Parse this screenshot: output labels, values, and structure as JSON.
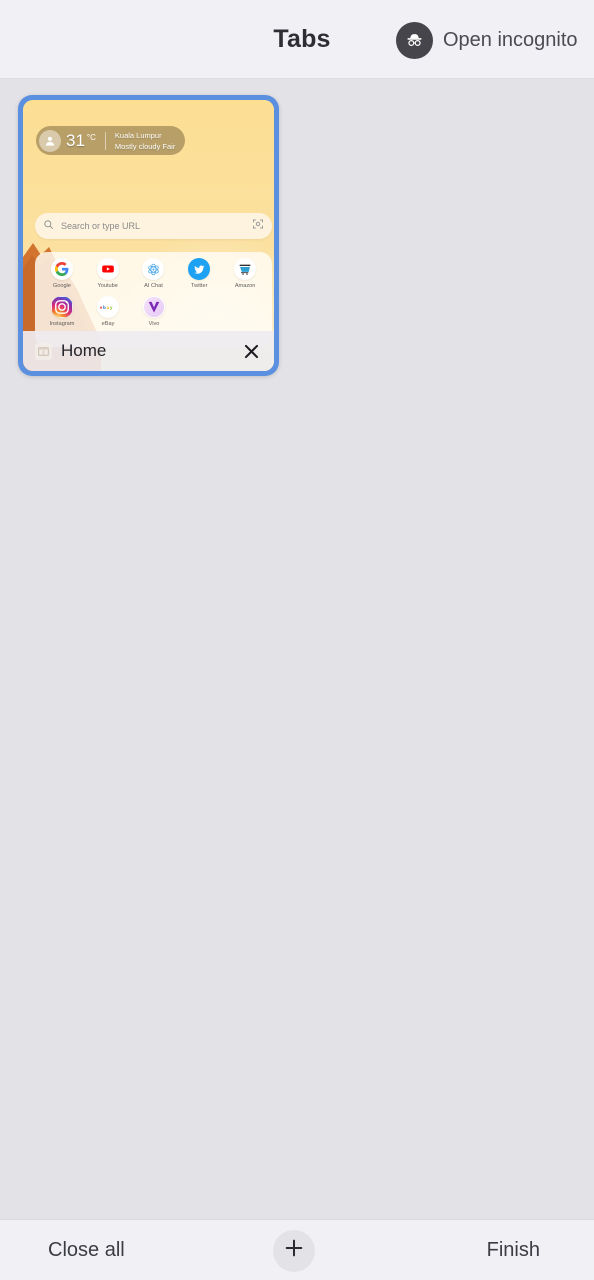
{
  "header": {
    "title": "Tabs",
    "incognito_label": "Open incognito",
    "incognito_icon": "incognito-hat-glasses-icon"
  },
  "tab_card": {
    "title": "Home",
    "favicon": "browser-home-favicon",
    "close_icon": "close-icon",
    "accent_color": "#5b8fe0",
    "wallpaper_color": "#fbdf95",
    "weather": {
      "avatar_icon": "user-avatar-icon",
      "temperature": "31",
      "unit": "°C",
      "city": "Kuala Lumpur",
      "condition": "Mostly cloudy  Fair"
    },
    "search": {
      "placeholder": "Search or type URL",
      "search_icon": "search-icon",
      "scan_icon": "qr-scan-icon"
    },
    "shortcuts_row1": [
      {
        "label": "Google",
        "icon": "google-icon"
      },
      {
        "label": "Youtube",
        "icon": "youtube-icon"
      },
      {
        "label": "AI Chat",
        "icon": "ai-chat-icon"
      },
      {
        "label": "Twitter",
        "icon": "twitter-icon"
      },
      {
        "label": "Amazon",
        "icon": "amazon-icon"
      }
    ],
    "shortcuts_row2": [
      {
        "label": "Instagram",
        "icon": "instagram-icon"
      },
      {
        "label": "eBay",
        "icon": "ebay-icon"
      },
      {
        "label": "Vivo",
        "icon": "vivo-icon"
      }
    ]
  },
  "bottom_bar": {
    "close_all_label": "Close all",
    "new_tab_icon": "plus-icon",
    "finish_label": "Finish"
  }
}
